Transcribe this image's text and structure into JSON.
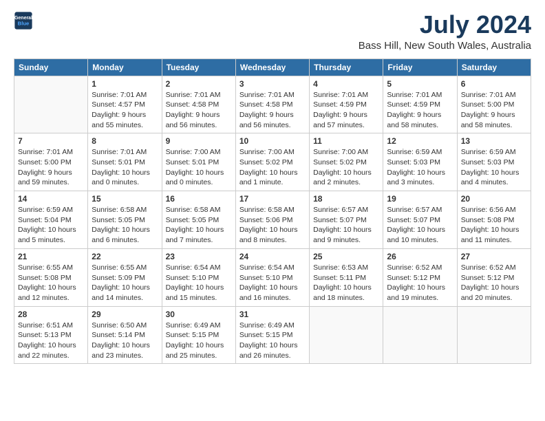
{
  "header": {
    "logo_line1": "General",
    "logo_line2": "Blue",
    "month_year": "July 2024",
    "location": "Bass Hill, New South Wales, Australia"
  },
  "weekdays": [
    "Sunday",
    "Monday",
    "Tuesday",
    "Wednesday",
    "Thursday",
    "Friday",
    "Saturday"
  ],
  "weeks": [
    [
      {
        "day": null,
        "info": null
      },
      {
        "day": "1",
        "sunrise": "7:01 AM",
        "sunset": "4:57 PM",
        "daylight": "9 hours and 55 minutes."
      },
      {
        "day": "2",
        "sunrise": "7:01 AM",
        "sunset": "4:58 PM",
        "daylight": "9 hours and 56 minutes."
      },
      {
        "day": "3",
        "sunrise": "7:01 AM",
        "sunset": "4:58 PM",
        "daylight": "9 hours and 56 minutes."
      },
      {
        "day": "4",
        "sunrise": "7:01 AM",
        "sunset": "4:59 PM",
        "daylight": "9 hours and 57 minutes."
      },
      {
        "day": "5",
        "sunrise": "7:01 AM",
        "sunset": "4:59 PM",
        "daylight": "9 hours and 58 minutes."
      },
      {
        "day": "6",
        "sunrise": "7:01 AM",
        "sunset": "5:00 PM",
        "daylight": "9 hours and 58 minutes."
      }
    ],
    [
      {
        "day": "7",
        "sunrise": "7:01 AM",
        "sunset": "5:00 PM",
        "daylight": "9 hours and 59 minutes."
      },
      {
        "day": "8",
        "sunrise": "7:01 AM",
        "sunset": "5:01 PM",
        "daylight": "10 hours and 0 minutes."
      },
      {
        "day": "9",
        "sunrise": "7:00 AM",
        "sunset": "5:01 PM",
        "daylight": "10 hours and 0 minutes."
      },
      {
        "day": "10",
        "sunrise": "7:00 AM",
        "sunset": "5:02 PM",
        "daylight": "10 hours and 1 minute."
      },
      {
        "day": "11",
        "sunrise": "7:00 AM",
        "sunset": "5:02 PM",
        "daylight": "10 hours and 2 minutes."
      },
      {
        "day": "12",
        "sunrise": "6:59 AM",
        "sunset": "5:03 PM",
        "daylight": "10 hours and 3 minutes."
      },
      {
        "day": "13",
        "sunrise": "6:59 AM",
        "sunset": "5:03 PM",
        "daylight": "10 hours and 4 minutes."
      }
    ],
    [
      {
        "day": "14",
        "sunrise": "6:59 AM",
        "sunset": "5:04 PM",
        "daylight": "10 hours and 5 minutes."
      },
      {
        "day": "15",
        "sunrise": "6:58 AM",
        "sunset": "5:05 PM",
        "daylight": "10 hours and 6 minutes."
      },
      {
        "day": "16",
        "sunrise": "6:58 AM",
        "sunset": "5:05 PM",
        "daylight": "10 hours and 7 minutes."
      },
      {
        "day": "17",
        "sunrise": "6:58 AM",
        "sunset": "5:06 PM",
        "daylight": "10 hours and 8 minutes."
      },
      {
        "day": "18",
        "sunrise": "6:57 AM",
        "sunset": "5:07 PM",
        "daylight": "10 hours and 9 minutes."
      },
      {
        "day": "19",
        "sunrise": "6:57 AM",
        "sunset": "5:07 PM",
        "daylight": "10 hours and 10 minutes."
      },
      {
        "day": "20",
        "sunrise": "6:56 AM",
        "sunset": "5:08 PM",
        "daylight": "10 hours and 11 minutes."
      }
    ],
    [
      {
        "day": "21",
        "sunrise": "6:55 AM",
        "sunset": "5:08 PM",
        "daylight": "10 hours and 12 minutes."
      },
      {
        "day": "22",
        "sunrise": "6:55 AM",
        "sunset": "5:09 PM",
        "daylight": "10 hours and 14 minutes."
      },
      {
        "day": "23",
        "sunrise": "6:54 AM",
        "sunset": "5:10 PM",
        "daylight": "10 hours and 15 minutes."
      },
      {
        "day": "24",
        "sunrise": "6:54 AM",
        "sunset": "5:10 PM",
        "daylight": "10 hours and 16 minutes."
      },
      {
        "day": "25",
        "sunrise": "6:53 AM",
        "sunset": "5:11 PM",
        "daylight": "10 hours and 18 minutes."
      },
      {
        "day": "26",
        "sunrise": "6:52 AM",
        "sunset": "5:12 PM",
        "daylight": "10 hours and 19 minutes."
      },
      {
        "day": "27",
        "sunrise": "6:52 AM",
        "sunset": "5:12 PM",
        "daylight": "10 hours and 20 minutes."
      }
    ],
    [
      {
        "day": "28",
        "sunrise": "6:51 AM",
        "sunset": "5:13 PM",
        "daylight": "10 hours and 22 minutes."
      },
      {
        "day": "29",
        "sunrise": "6:50 AM",
        "sunset": "5:14 PM",
        "daylight": "10 hours and 23 minutes."
      },
      {
        "day": "30",
        "sunrise": "6:49 AM",
        "sunset": "5:15 PM",
        "daylight": "10 hours and 25 minutes."
      },
      {
        "day": "31",
        "sunrise": "6:49 AM",
        "sunset": "5:15 PM",
        "daylight": "10 hours and 26 minutes."
      },
      {
        "day": null,
        "info": null
      },
      {
        "day": null,
        "info": null
      },
      {
        "day": null,
        "info": null
      }
    ]
  ]
}
